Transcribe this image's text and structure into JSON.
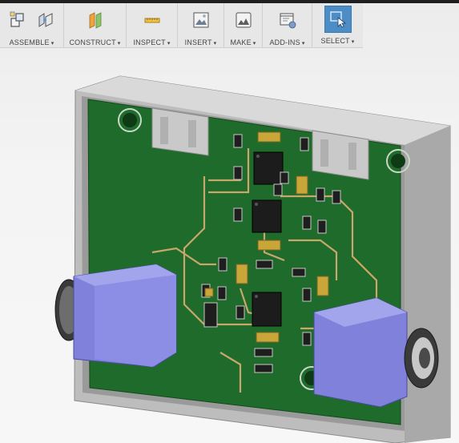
{
  "toolbar": {
    "groups": [
      {
        "label": "ASSEMBLE",
        "icons": [
          "new-component-icon",
          "joint-icon"
        ]
      },
      {
        "label": "CONSTRUCT",
        "icons": [
          "offset-plane-icon"
        ]
      },
      {
        "label": "INSPECT",
        "icons": [
          "measure-icon"
        ]
      },
      {
        "label": "INSERT",
        "icons": [
          "insert-image-icon"
        ]
      },
      {
        "label": "MAKE",
        "icons": [
          "make-icon"
        ]
      },
      {
        "label": "ADD-INS",
        "icons": [
          "scripts-addins-icon"
        ]
      },
      {
        "label": "SELECT",
        "icons": [
          "select-cursor-icon"
        ]
      }
    ],
    "dropdown_glyph": "▾"
  },
  "viewport": {
    "model": "pcb-assembly-in-enclosure",
    "colors": {
      "board": "#1f6b2b",
      "copper_trace": "#c8a86a",
      "connector": "#8c8ee6",
      "enclosure": "#cfcfcf",
      "ic": "#1c1c1c",
      "capacitor": "#c9a63a"
    }
  }
}
